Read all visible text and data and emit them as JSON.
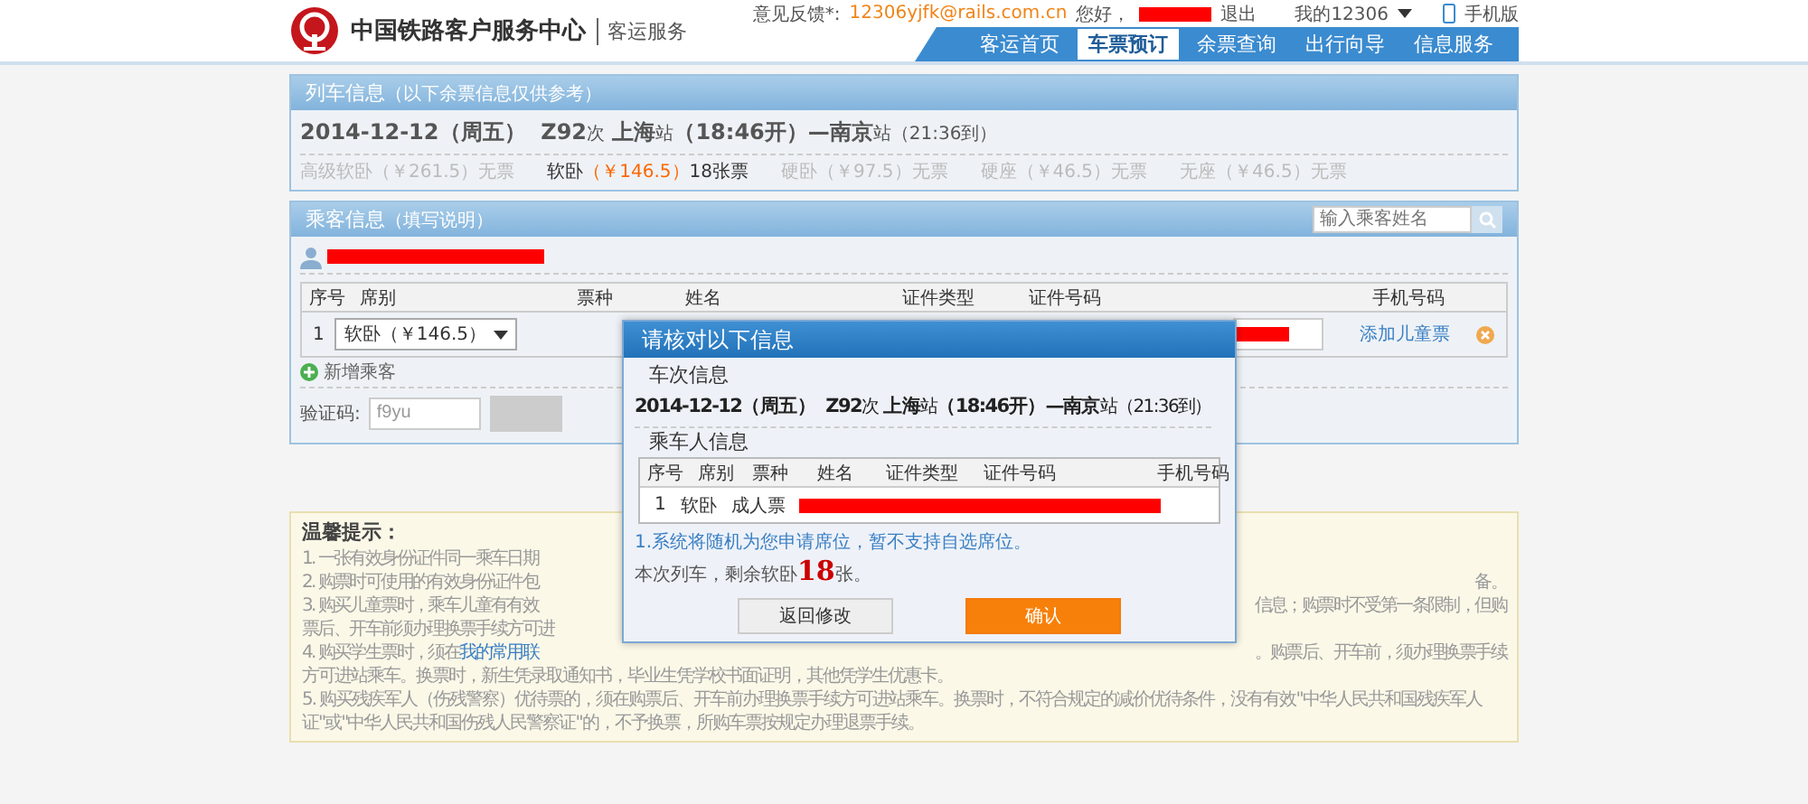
{
  "header": {
    "site_title": "中国铁路客户服务中心",
    "section": "客运服务",
    "feedback_label": "意见反馈*:",
    "feedback_email": "12306yjfk@rails.com.cn",
    "greeting": "您好，",
    "logout": "退出",
    "my_account": "我的12306",
    "mobile": "手机版"
  },
  "nav": [
    {
      "label": "客运首页",
      "selected": false
    },
    {
      "label": "车票预订",
      "selected": true
    },
    {
      "label": "余票查询",
      "selected": false
    },
    {
      "label": "出行向导",
      "selected": false
    },
    {
      "label": "信息服务",
      "selected": false
    }
  ],
  "train_panel": {
    "title": "列车信息",
    "subtitle": "（以下余票信息仅供参考）",
    "summary": [
      {
        "text": "2014-12-12（周五）  Z92",
        "small": false
      },
      {
        "text": "次",
        "small": true
      },
      {
        "text": " 上海",
        "small": false
      },
      {
        "text": "站",
        "small": true
      },
      {
        "text": "（18:46开）—南京",
        "small": false
      },
      {
        "text": "站",
        "small": true
      },
      {
        "text": "（21:36到）",
        "small": true
      }
    ],
    "seats": [
      {
        "name": "高级软卧",
        "price": "（￥261.5）",
        "status": "无票",
        "available": false
      },
      {
        "name": "软卧",
        "price": "（￥146.5）",
        "status": "18张票",
        "available": true
      },
      {
        "name": "硬卧",
        "price": "（￥97.5）",
        "status": "无票",
        "available": false
      },
      {
        "name": "硬座",
        "price": "（￥46.5）",
        "status": "无票",
        "available": false
      },
      {
        "name": "无座",
        "price": "（￥46.5）",
        "status": "无票",
        "available": false
      }
    ]
  },
  "passenger_panel": {
    "title": "乘客信息",
    "subtitle": "（填写说明）",
    "search_placeholder": "输入乘客姓名",
    "columns": [
      "序号",
      "席别",
      "票种",
      "姓名",
      "证件类型",
      "证件号码",
      "手机号码"
    ],
    "row": {
      "index": "1",
      "seat": "软卧（￥146.5）",
      "add_child": "添加儿童票"
    },
    "add_passenger": "新增乘客",
    "captcha_label": "验证码:",
    "captcha_value": "f9yu"
  },
  "tips": {
    "title": "温馨提示：",
    "lines": [
      {
        "kind": "split",
        "left": "1. 一张有效身份证件同一乘车日期"
      },
      {
        "kind": "split",
        "left": "2. 购票时可使用的有效身份证件包",
        "right": "备。"
      },
      {
        "kind": "split",
        "left": "3. 购买儿童票时，乘车儿童有有效",
        "right": "信息；购票时不受第一条限制，但购"
      },
      {
        "kind": "split",
        "left": "票后、开车前须办理换票手续方可进"
      },
      {
        "kind": "split",
        "left": "4. 购买学生票时，须在",
        "link": "我的常用联",
        "right": "。购票后、开车前，须办理换票手续"
      },
      {
        "kind": "full",
        "left": "方可进站乘车。换票时，新生凭录取通知书，毕业生凭学校书面证明，其他凭学生优惠卡。"
      },
      {
        "kind": "full",
        "left": "5. 购买残疾军人（伤残警察）优待票的，须在购票后、开车前办理换票手续方可进站乘车。换票时，不符合规定的减价优待条件，没有有效\"中华人民共和国残疾军人证\"或\"中华人民共和国伤残人民警察证\"的，不予换票，所购车票按规定办理退票手续。"
      }
    ]
  },
  "dialog": {
    "title": "请核对以下信息",
    "train_heading": "车次信息",
    "summary": [
      {
        "text": "2014-12-12（周五）  Z92",
        "small": false
      },
      {
        "text": "次",
        "small": true
      },
      {
        "text": " 上海",
        "small": false
      },
      {
        "text": "站",
        "small": true
      },
      {
        "text": "（18:46开）—南京",
        "small": false
      },
      {
        "text": "站",
        "small": true
      },
      {
        "text": "（21:36到）",
        "small": true
      }
    ],
    "passenger_heading": "乘车人信息",
    "columns": [
      "序号",
      "席别",
      "票种",
      "姓名",
      "证件类型",
      "证件号码",
      "手机号码"
    ],
    "row": [
      "1",
      "软卧",
      "成人票"
    ],
    "note": "1.系统将随机为您申请席位，暂不支持自选席位。",
    "remaining": "本次列车，剩余软卧**18**张。",
    "buttons": [
      {
        "label": "返回修改",
        "kind": "secondary"
      },
      {
        "label": "确认",
        "kind": "primary"
      }
    ]
  }
}
